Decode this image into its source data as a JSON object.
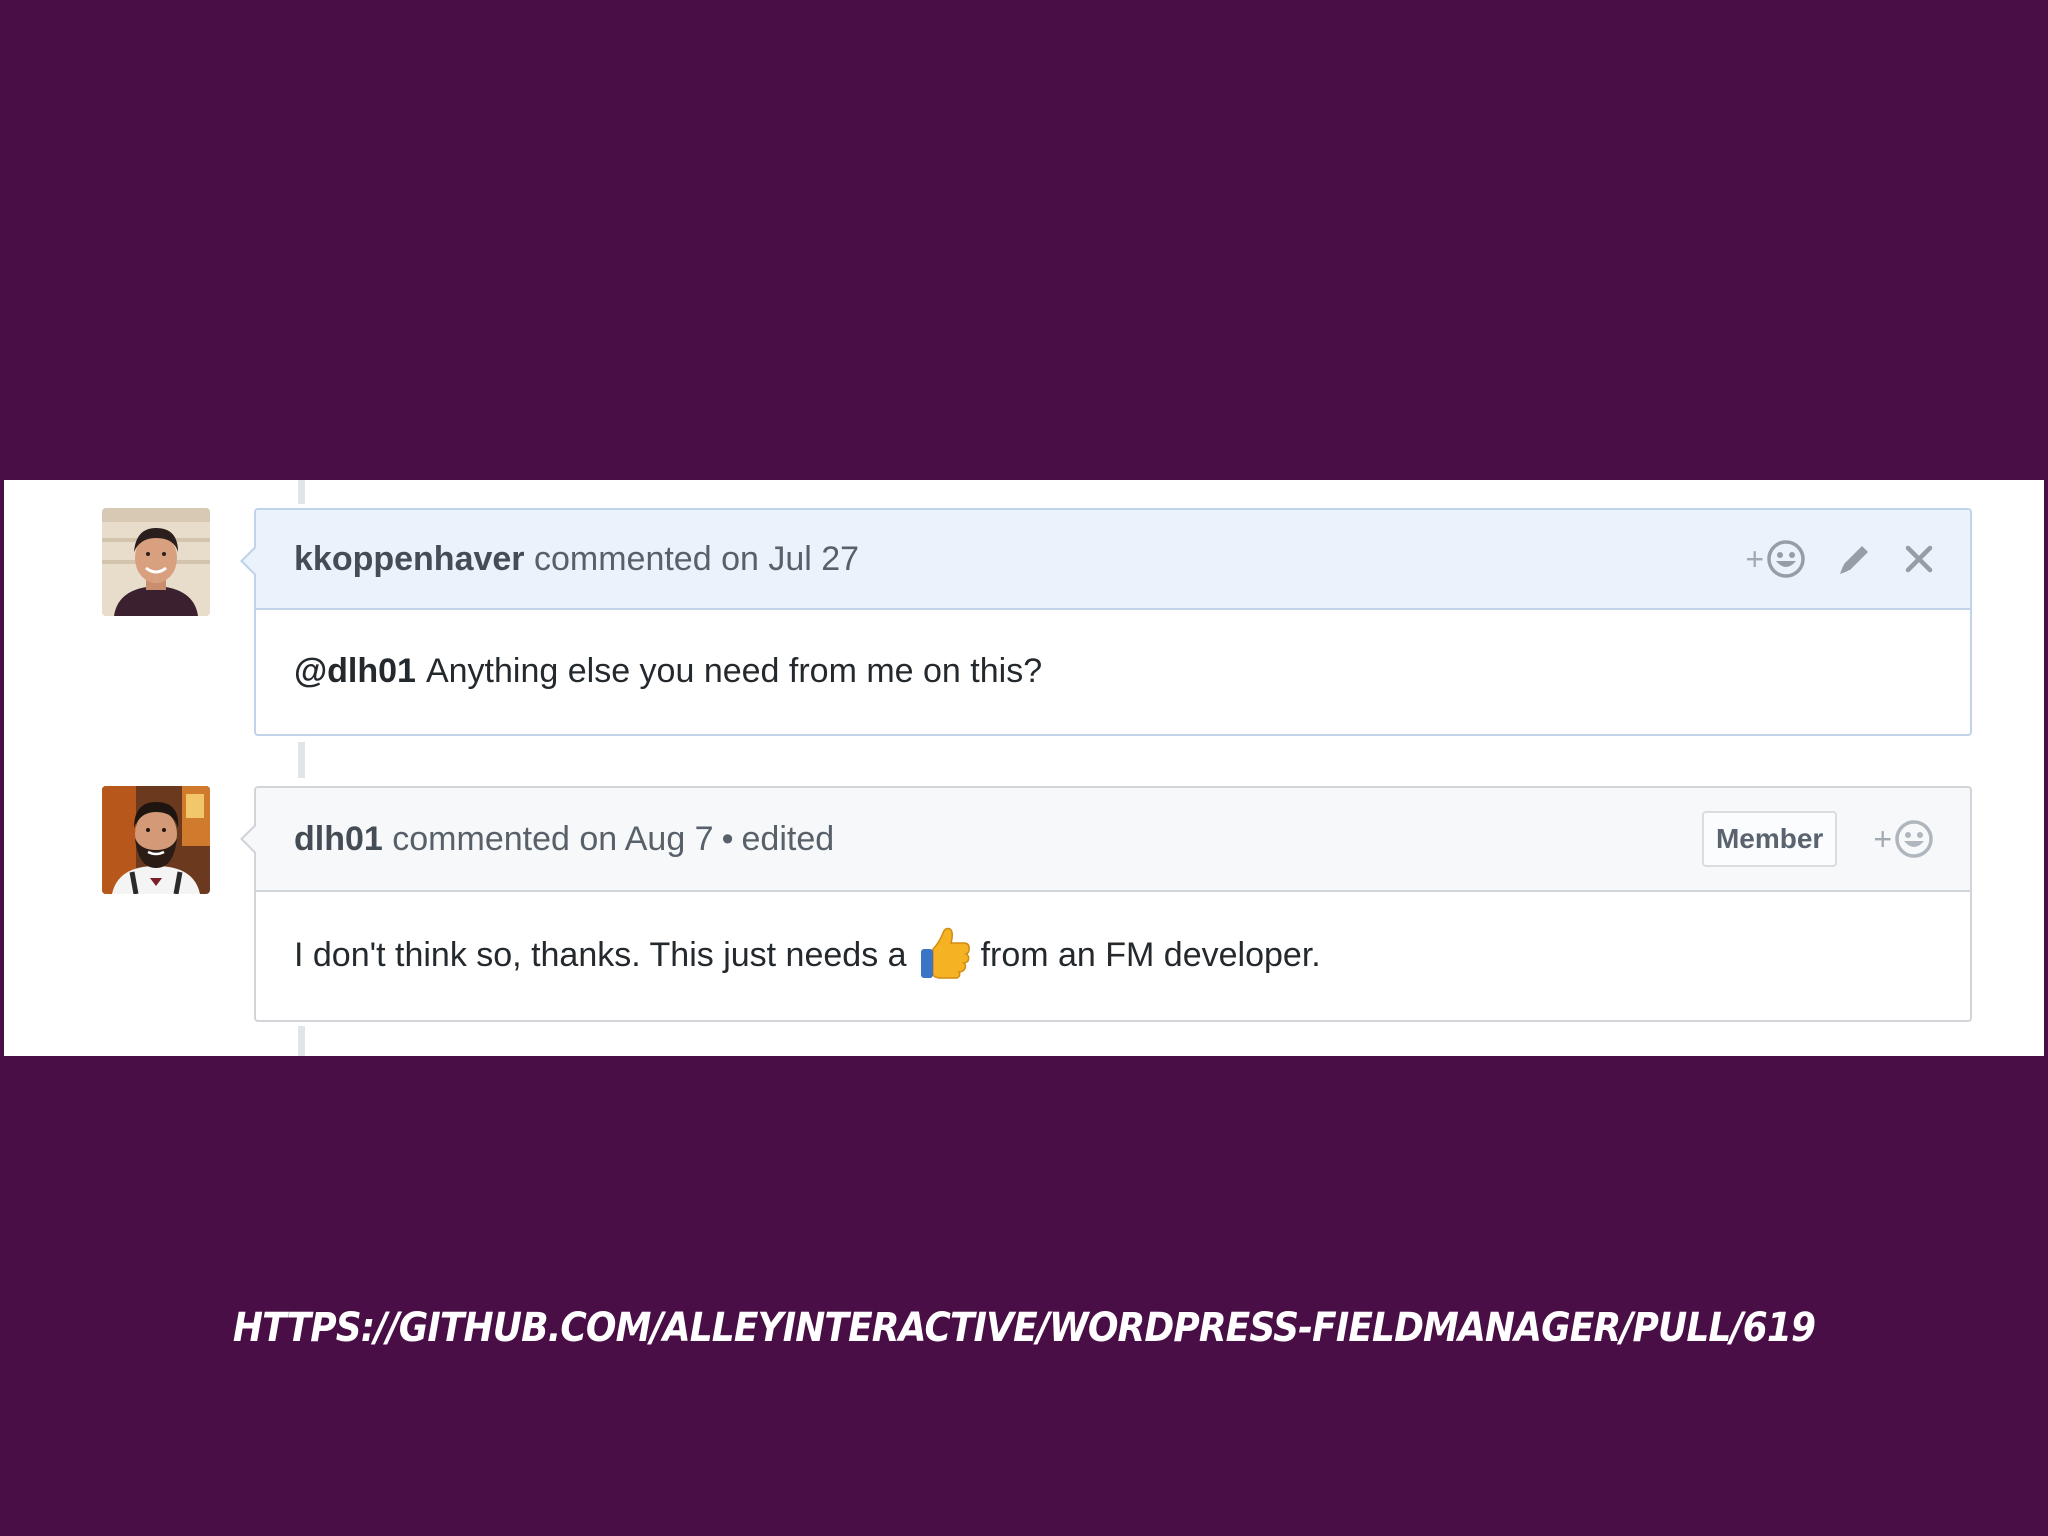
{
  "comments": [
    {
      "author": "kkoppenhaver",
      "meta": "commented on Jul 27",
      "mention": "@dlh01",
      "body": "Anything else you need from me on this?",
      "actions": [
        "add-reaction-icon",
        "pencil-icon",
        "close-icon"
      ]
    },
    {
      "author": "dlh01",
      "meta": "commented on Aug 7",
      "edited_label": "edited",
      "badge": "Member",
      "body_before": "I don't think so, thanks. This just needs a",
      "emoji": "thumbs-up",
      "body_after": "from an FM developer.",
      "actions": [
        "add-reaction-icon"
      ]
    }
  ],
  "reaction_plus": "+",
  "footer": {
    "url": "HTTPS://GITHUB.COM/ALLEYINTERACTIVE/WORDPRESS-FIELDMANAGER/PULL/619"
  },
  "colors": {
    "slide_background": "#4a0e46",
    "header_own": "#eaf2fb",
    "header_other": "#f6f8fa"
  }
}
